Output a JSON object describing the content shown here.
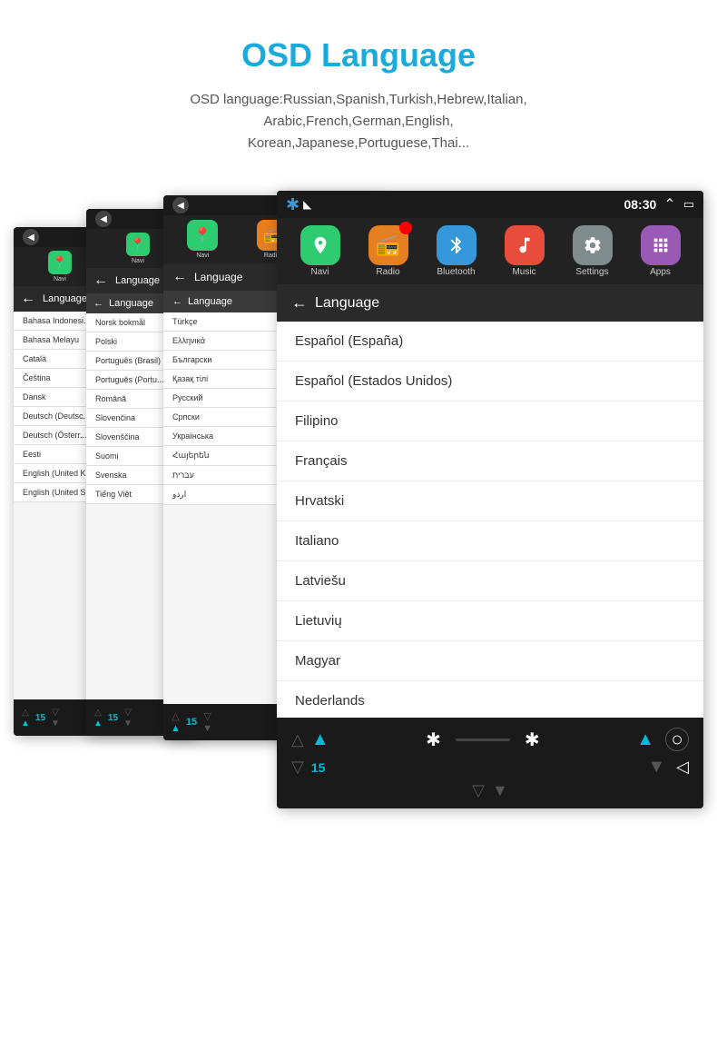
{
  "header": {
    "title": "OSD Language",
    "subtitle": "OSD language:Russian,Spanish,Turkish,Hebrew,Italian,\nArabic,French,German,English,\nKorean,Japanese,Portuguese,Thai..."
  },
  "screenshots": {
    "status": {
      "time": "08:30",
      "icons": [
        "✱",
        "◣",
        "≋",
        "⌅"
      ]
    },
    "nav_items": [
      {
        "id": "navi",
        "label": "Navi",
        "icon": "📍",
        "color_class": "icon-navi",
        "symbol": "⊙"
      },
      {
        "id": "radio",
        "label": "Radio",
        "icon": "📻",
        "color_class": "icon-radio",
        "symbol": "⋮⋮"
      },
      {
        "id": "bluetooth",
        "label": "Bluetooth",
        "icon": "✱",
        "color_class": "icon-bt",
        "symbol": "ᛒ"
      },
      {
        "id": "music",
        "label": "Music",
        "icon": "♪",
        "color_class": "icon-music",
        "symbol": "♫"
      },
      {
        "id": "settings",
        "label": "Settings",
        "icon": "⚙",
        "color_class": "icon-settings",
        "symbol": "⚙"
      },
      {
        "id": "apps",
        "label": "Apps",
        "icon": "⊞",
        "color_class": "icon-apps",
        "symbol": "⊞"
      }
    ],
    "language_screen": {
      "title": "Language",
      "items_main": [
        "Español (España)",
        "Español (Estados Unidos)",
        "Filipino",
        "Français",
        "Hrvatski",
        "Italiano",
        "Latviešu",
        "Lietuvių",
        "Magyar",
        "Nederlands"
      ],
      "items_layer3": [
        "Türkçe",
        "Ελληνικά",
        "Български",
        "Қазақ тілі",
        "Русский",
        "Српски",
        "Українська",
        "Հայերեն",
        "עברית",
        "اردو"
      ],
      "items_layer2": [
        "Norsk bokmål",
        "Polski",
        "Português (Brasil)",
        "Português (Portu...)",
        "Română",
        "Slovenčina",
        "Slovenščina",
        "Suomi",
        "Svenska",
        "Tiếng Việt"
      ],
      "items_layer1": [
        "Bahasa Indonesi...",
        "Bahasa Melayu",
        "Català",
        "Čeština",
        "Dansk",
        "Deutsch (Deutsc...)",
        "Deutsch (Österr...)",
        "Eesti",
        "English (United K...)",
        "English (United S...)"
      ]
    },
    "bottom_control": {
      "number": "15"
    }
  }
}
